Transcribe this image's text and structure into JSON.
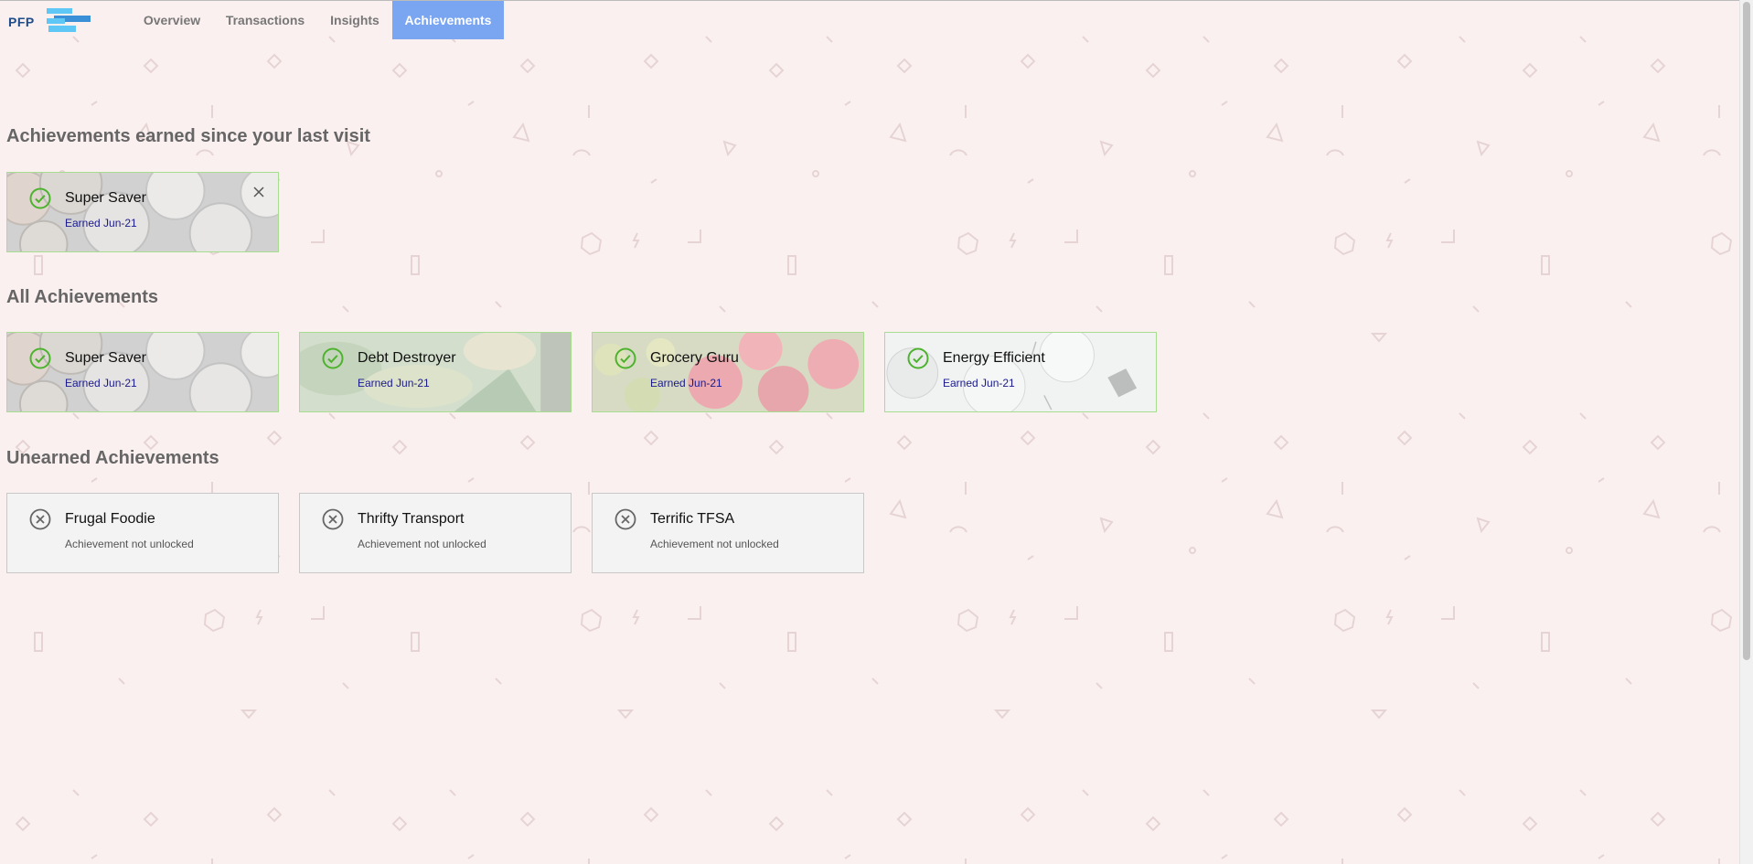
{
  "nav": {
    "logo_text": "PFP",
    "tabs": [
      {
        "label": "Overview"
      },
      {
        "label": "Transactions"
      },
      {
        "label": "Insights"
      },
      {
        "label": "Achievements"
      }
    ]
  },
  "sections": {
    "recent_title": "Achievements earned since your last visit",
    "all_title": "All Achievements",
    "unearned_title": "Unearned Achievements"
  },
  "recent": [
    {
      "name": "Super Saver",
      "status": "Earned Jun-21"
    }
  ],
  "all": [
    {
      "name": "Super Saver",
      "status": "Earned Jun-21"
    },
    {
      "name": "Debt Destroyer",
      "status": "Earned Jun-21"
    },
    {
      "name": "Grocery Guru",
      "status": "Earned Jun-21"
    },
    {
      "name": "Energy Efficient",
      "status": "Earned Jun-21"
    }
  ],
  "unearned": [
    {
      "name": "Frugal Foodie",
      "status": "Achievement not unlocked"
    },
    {
      "name": "Thrifty Transport",
      "status": "Achievement not unlocked"
    },
    {
      "name": "Terrific TFSA",
      "status": "Achievement not unlocked"
    }
  ],
  "colors": {
    "accent": "#7aa5f0",
    "earned_check": "#4db32e",
    "earned_border": "#a7dd8e",
    "earned_text": "#1a1a8e",
    "background": "#fbf0f0",
    "logo_text": "#1f4d8a",
    "logo_bars": "#4fc3f7"
  },
  "icons": {
    "earned": "check-circle-icon",
    "unearned": "x-circle-icon",
    "dismiss": "close-icon"
  }
}
